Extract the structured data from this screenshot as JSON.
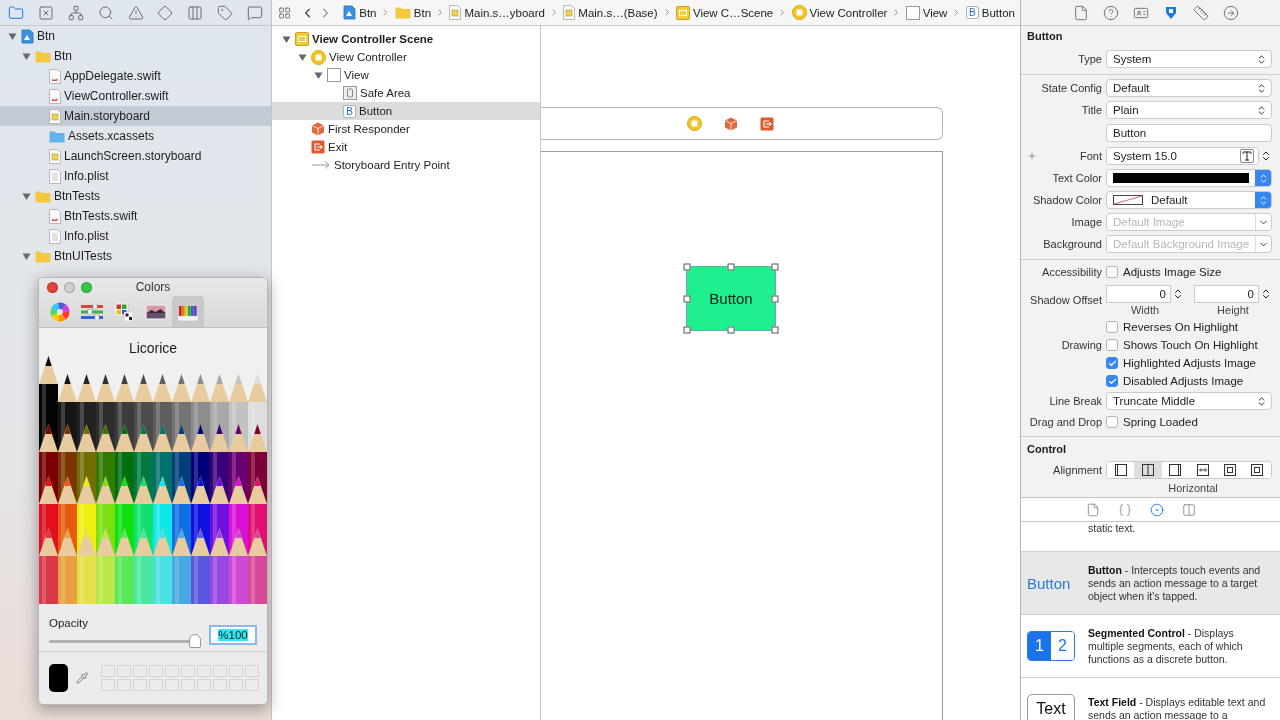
{
  "navigator": {
    "toolbar": [
      {
        "kind": "folder",
        "selected": true
      },
      {
        "kind": "source_control",
        "selected": false
      },
      {
        "kind": "hierarchy",
        "selected": false
      },
      {
        "kind": "search",
        "selected": false
      },
      {
        "kind": "warning",
        "selected": false
      },
      {
        "kind": "test",
        "selected": false
      },
      {
        "kind": "debug",
        "selected": false
      },
      {
        "kind": "breakpoint",
        "selected": false
      },
      {
        "kind": "report",
        "selected": false
      }
    ],
    "tree": [
      {
        "kind": "project",
        "label": "Btn",
        "expanded": true,
        "selected": false,
        "children": [
          {
            "kind": "folder",
            "label": "Btn",
            "expanded": true,
            "selected": false,
            "children": [
              {
                "kind": "swift",
                "label": "AppDelegate.swift",
                "selected": false
              },
              {
                "kind": "swift",
                "label": "ViewController.swift",
                "selected": false
              },
              {
                "kind": "storyboard",
                "label": "Main.storyboard",
                "selected": true
              },
              {
                "kind": "assets",
                "label": "Assets.xcassets",
                "selected": false
              },
              {
                "kind": "storyboard",
                "label": "LaunchScreen.storyboard",
                "selected": false
              },
              {
                "kind": "plist",
                "label": "Info.plist",
                "selected": false
              }
            ]
          },
          {
            "kind": "folder",
            "label": "BtnTests",
            "expanded": true,
            "selected": false,
            "children": [
              {
                "kind": "swift",
                "label": "BtnTests.swift",
                "selected": false
              },
              {
                "kind": "plist",
                "label": "Info.plist",
                "selected": false
              }
            ]
          },
          {
            "kind": "folder",
            "label": "BtnUITests",
            "expanded": true,
            "selected": false
          }
        ]
      }
    ]
  },
  "jump_bar": {
    "items": [
      {
        "kind": "project",
        "label": "Btn"
      },
      {
        "kind": "folder",
        "label": "Btn"
      },
      {
        "kind": "storyboard",
        "label": "Main.s…yboard"
      },
      {
        "kind": "storyboard",
        "label": "Main.s…(Base)"
      },
      {
        "kind": "scene",
        "label": "View C…Scene"
      },
      {
        "kind": "controller",
        "label": "View Controller"
      },
      {
        "kind": "view",
        "label": "View"
      },
      {
        "kind": "button",
        "badge": "B",
        "label": "Button"
      }
    ]
  },
  "outline": [
    {
      "kind": "scene",
      "label": "View Controller Scene",
      "expanded": true,
      "selected": false,
      "children": [
        {
          "kind": "controller",
          "label": "View Controller",
          "expanded": true,
          "selected": false,
          "children": [
            {
              "kind": "view",
              "label": "View",
              "expanded": true,
              "selected": false,
              "children": [
                {
                  "kind": "safe_area",
                  "label": "Safe Area",
                  "selected": false
                },
                {
                  "kind": "button",
                  "badge": "B",
                  "label": "Button",
                  "selected": true
                }
              ]
            }
          ]
        },
        {
          "kind": "responder",
          "label": "First Responder",
          "selected": false
        },
        {
          "kind": "exit",
          "label": "Exit",
          "selected": false
        },
        {
          "kind": "entry",
          "label": "Storyboard Entry Point",
          "selected": false
        }
      ]
    }
  ],
  "canvas": {
    "scene_dock": [
      {
        "kind": "controller"
      },
      {
        "kind": "responder"
      },
      {
        "kind": "exit"
      }
    ],
    "button": {
      "label": "Button",
      "selected": true
    }
  },
  "colors_panel": {
    "title": "Colors",
    "modes": [
      {
        "kind": "wheel",
        "selected": false
      },
      {
        "kind": "sliders",
        "selected": false
      },
      {
        "kind": "palettes",
        "selected": false
      },
      {
        "kind": "image",
        "selected": false
      },
      {
        "kind": "pencils",
        "selected": true
      }
    ],
    "color_name": "Licorice",
    "opacity": {
      "label": "Opacity",
      "level": 1,
      "value": "%100"
    }
  },
  "inspector": {
    "tabs": [
      {
        "kind": "file",
        "selected": false
      },
      {
        "kind": "help",
        "selected": false
      },
      {
        "kind": "identity",
        "selected": false
      },
      {
        "kind": "attributes",
        "selected": true
      },
      {
        "kind": "size",
        "selected": false
      },
      {
        "kind": "connections",
        "selected": false
      }
    ],
    "title": "Button",
    "groups": [
      [
        {
          "kind": "select",
          "label": "Type",
          "value": "System"
        }
      ],
      [
        {
          "kind": "select",
          "label": "State Config",
          "value": "Default"
        },
        {
          "kind": "select",
          "label": "Title",
          "value": "Plain"
        },
        {
          "kind": "text",
          "value": "Button"
        },
        {
          "kind": "font",
          "label": "Font",
          "value": "System 15.0"
        },
        {
          "kind": "color",
          "label": "Text Color",
          "color": "#000000"
        },
        {
          "kind": "color",
          "label": "Shadow Color",
          "value": "Default"
        },
        {
          "kind": "combo",
          "label": "Image",
          "placeholder": "Default Image"
        },
        {
          "kind": "combo",
          "label": "Background",
          "placeholder": "Default Background Image"
        }
      ],
      [
        {
          "kind": "checkbox",
          "label": "Accessibility",
          "text": "Adjusts Image Size",
          "checked": false
        },
        {
          "kind": "offset",
          "label": "Shadow Offset",
          "fields": [
            {
              "value": "0",
              "caption": "Width"
            },
            {
              "value": "0",
              "caption": "Height"
            }
          ]
        },
        {
          "kind": "checkbox",
          "text": "Reverses On Highlight",
          "checked": false
        },
        {
          "kind": "checkbox",
          "label": "Drawing",
          "text": "Shows Touch On Highlight",
          "checked": false
        },
        {
          "kind": "checkbox",
          "text": "Highlighted Adjusts Image",
          "checked": true
        },
        {
          "kind": "checkbox",
          "text": "Disabled Adjusts Image",
          "checked": true
        },
        {
          "kind": "select",
          "label": "Line Break",
          "value": "Truncate Middle"
        },
        {
          "kind": "checkbox",
          "label": "Drag and Drop",
          "text": "Spring Loaded",
          "checked": false
        }
      ]
    ],
    "control": {
      "title": "Control",
      "label": "Alignment",
      "segments": [
        {
          "kind": "left",
          "selected": false
        },
        {
          "kind": "center",
          "selected": true
        },
        {
          "kind": "right",
          "selected": false
        },
        {
          "kind": "fill",
          "selected": false
        },
        {
          "kind": "leading",
          "selected": false
        },
        {
          "kind": "trailing",
          "selected": false
        }
      ],
      "caption": "Horizontal"
    }
  },
  "library": {
    "tabs": [
      {
        "kind": "file",
        "selected": false
      },
      {
        "kind": "code",
        "selected": false
      },
      {
        "kind": "object",
        "selected": true
      },
      {
        "kind": "media",
        "selected": false
      }
    ],
    "items": [
      {
        "kind": "partial",
        "description": "static text.",
        "selected": false
      },
      {
        "kind": "button",
        "preview": "Button",
        "description": "**Button** - Intercepts touch events and sends an action message to a target object when it's tapped.",
        "selected": true
      },
      {
        "kind": "segmented",
        "segments": [
          {
            "label": "1",
            "selected": true
          },
          {
            "label": "2",
            "selected": false
          }
        ],
        "description": "**Segmented Control** - Displays multiple segments, each of which functions as a discrete button.",
        "selected": false
      },
      {
        "kind": "textfield",
        "preview": "Text",
        "description": "**Text Field** - Displays editable text and sends an action message to a",
        "selected": false
      }
    ]
  }
}
